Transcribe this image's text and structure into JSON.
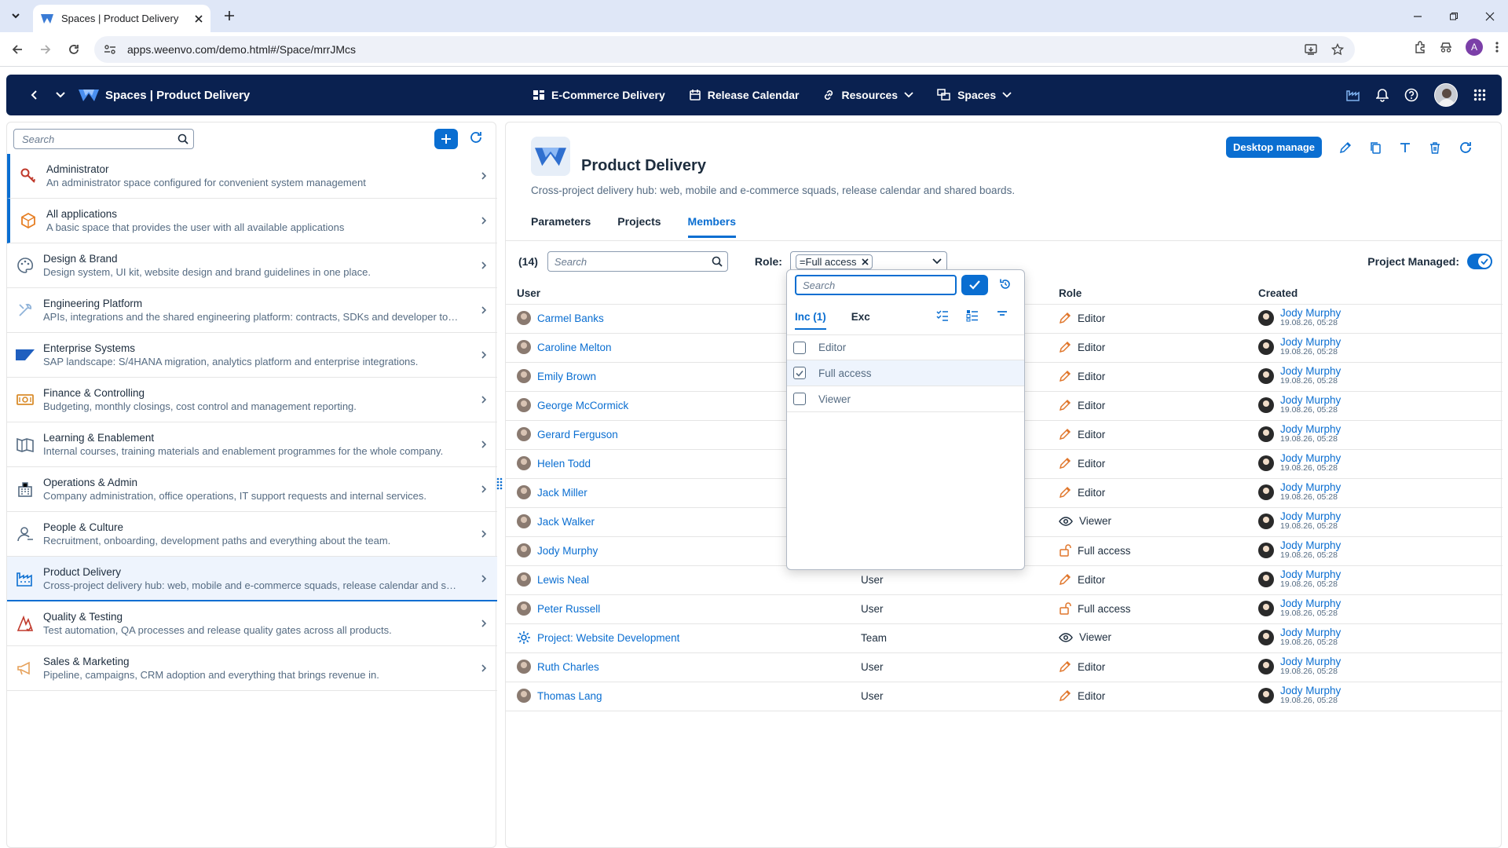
{
  "browser": {
    "tab_title": "Spaces | Product Delivery",
    "url": "apps.weenvo.com/demo.html#/Space/mrrJMcs",
    "profile_initial": "A"
  },
  "header": {
    "title": "Spaces | Product Delivery",
    "nav": [
      {
        "label": "E-Commerce Delivery",
        "icon": "dashboard-icon"
      },
      {
        "label": "Release Calendar",
        "icon": "calendar-icon"
      },
      {
        "label": "Resources",
        "icon": "link-icon"
      },
      {
        "label": "Spaces",
        "icon": "spaces-icon"
      }
    ]
  },
  "sidebar": {
    "search_placeholder": "Search",
    "items": [
      {
        "title": "Administrator",
        "desc": "An administrator space configured for convenient system management",
        "icon": "key-icon",
        "color": "#c0392b"
      },
      {
        "title": "All applications",
        "desc": "A basic space that provides the user with all available applications",
        "icon": "cube-icon",
        "color": "#e67e22"
      },
      {
        "title": "Design & Brand",
        "desc": "Design system, UI kit, website design and brand guidelines in one place.",
        "icon": "palette-icon",
        "color": "#556b82"
      },
      {
        "title": "Engineering Platform",
        "desc": "APIs, integrations and the shared engineering platform: contracts, SDKs and developer tools.",
        "icon": "tools-icon",
        "color": "#8fb3d9"
      },
      {
        "title": "Enterprise Systems",
        "desc": "SAP landscape: S/4HANA migration, analytics platform and enterprise integrations.",
        "icon": "sap-icon",
        "color": "#1f5fbf"
      },
      {
        "title": "Finance & Controlling",
        "desc": "Budgeting, monthly closings, cost control and management reporting.",
        "icon": "money-icon",
        "color": "#d98c2b"
      },
      {
        "title": "Learning & Enablement",
        "desc": "Internal courses, training materials and enablement programmes for the whole company.",
        "icon": "book-icon",
        "color": "#556b82"
      },
      {
        "title": "Operations & Admin",
        "desc": "Company administration, office operations, IT support requests and internal services.",
        "icon": "building-icon",
        "color": "#556b82"
      },
      {
        "title": "People & Culture",
        "desc": "Recruitment, onboarding, development paths and everything about the team.",
        "icon": "person-icon",
        "color": "#556b82"
      },
      {
        "title": "Product Delivery",
        "desc": "Cross-project delivery hub: web, mobile and e-commerce squads, release calendar and shared boards.",
        "icon": "factory-icon",
        "color": "#0a6ed1"
      },
      {
        "title": "Quality & Testing",
        "desc": "Test automation, QA processes and release quality gates across all products.",
        "icon": "quality-icon",
        "color": "#c0392b"
      },
      {
        "title": "Sales & Marketing",
        "desc": "Pipeline, campaigns, CRM adoption and everything that brings revenue in.",
        "icon": "megaphone-icon",
        "color": "#e6a15a"
      }
    ]
  },
  "page": {
    "title": "Product Delivery",
    "description": "Cross-project delivery hub: web, mobile and e-commerce squads, release calendar and shared boards.",
    "desktop_manage": "Desktop manage",
    "tabs": [
      "Parameters",
      "Projects",
      "Members"
    ],
    "active_tab": "Members"
  },
  "filters": {
    "count": "(14)",
    "search_placeholder": "Search",
    "role_label": "Role:",
    "role_token": "=Full access",
    "project_managed_label": "Project Managed:"
  },
  "table": {
    "headers": {
      "user": "User",
      "role": "Role",
      "created": "Created"
    },
    "rows": [
      {
        "user": "Carmel Banks",
        "type": "",
        "role": "Editor",
        "role_icon": "pencil-icon",
        "created_by": "Jody Murphy",
        "created_at": "19.08.26, 05:28"
      },
      {
        "user": "Caroline Melton",
        "type": "",
        "role": "Editor",
        "role_icon": "pencil-icon",
        "created_by": "Jody Murphy",
        "created_at": "19.08.26, 05:28"
      },
      {
        "user": "Emily Brown",
        "type": "",
        "role": "Editor",
        "role_icon": "pencil-icon",
        "created_by": "Jody Murphy",
        "created_at": "19.08.26, 05:28"
      },
      {
        "user": "George McCormick",
        "type": "",
        "role": "Editor",
        "role_icon": "pencil-icon",
        "created_by": "Jody Murphy",
        "created_at": "19.08.26, 05:28"
      },
      {
        "user": "Gerard Ferguson",
        "type": "",
        "role": "Editor",
        "role_icon": "pencil-icon",
        "created_by": "Jody Murphy",
        "created_at": "19.08.26, 05:28"
      },
      {
        "user": "Helen Todd",
        "type": "",
        "role": "Editor",
        "role_icon": "pencil-icon",
        "created_by": "Jody Murphy",
        "created_at": "19.08.26, 05:28"
      },
      {
        "user": "Jack Miller",
        "type": "",
        "role": "Editor",
        "role_icon": "pencil-icon",
        "created_by": "Jody Murphy",
        "created_at": "19.08.26, 05:28"
      },
      {
        "user": "Jack Walker",
        "type": "",
        "role": "Viewer",
        "role_icon": "eye-icon",
        "created_by": "Jody Murphy",
        "created_at": "19.08.26, 05:28"
      },
      {
        "user": "Jody Murphy",
        "type": "",
        "role": "Full access",
        "role_icon": "unlock-icon",
        "created_by": "Jody Murphy",
        "created_at": "19.08.26, 05:28"
      },
      {
        "user": "Lewis Neal",
        "type": "User",
        "role": "Editor",
        "role_icon": "pencil-icon",
        "created_by": "Jody Murphy",
        "created_at": "19.08.26, 05:28"
      },
      {
        "user": "Peter Russell",
        "type": "User",
        "role": "Full access",
        "role_icon": "unlock-icon",
        "created_by": "Jody Murphy",
        "created_at": "19.08.26, 05:28"
      },
      {
        "user": "Project: Website Development",
        "type": "Team",
        "role": "Viewer",
        "role_icon": "eye-icon",
        "created_by": "Jody Murphy",
        "created_at": "19.08.26, 05:28"
      },
      {
        "user": "Ruth Charles",
        "type": "User",
        "role": "Editor",
        "role_icon": "pencil-icon",
        "created_by": "Jody Murphy",
        "created_at": "19.08.26, 05:28"
      },
      {
        "user": "Thomas Lang",
        "type": "User",
        "role": "Editor",
        "role_icon": "pencil-icon",
        "created_by": "Jody Murphy",
        "created_at": "19.08.26, 05:28"
      }
    ]
  },
  "popup": {
    "search_placeholder": "Search",
    "tab_include": "Inc (1)",
    "tab_exclude": "Exc",
    "options": [
      {
        "label": "Editor",
        "checked": false
      },
      {
        "label": "Full access",
        "checked": true
      },
      {
        "label": "Viewer",
        "checked": false
      }
    ]
  },
  "colors": {
    "accent": "#0a6ed1",
    "header_bg": "#0a2150",
    "role_icon": "#e0762b"
  }
}
